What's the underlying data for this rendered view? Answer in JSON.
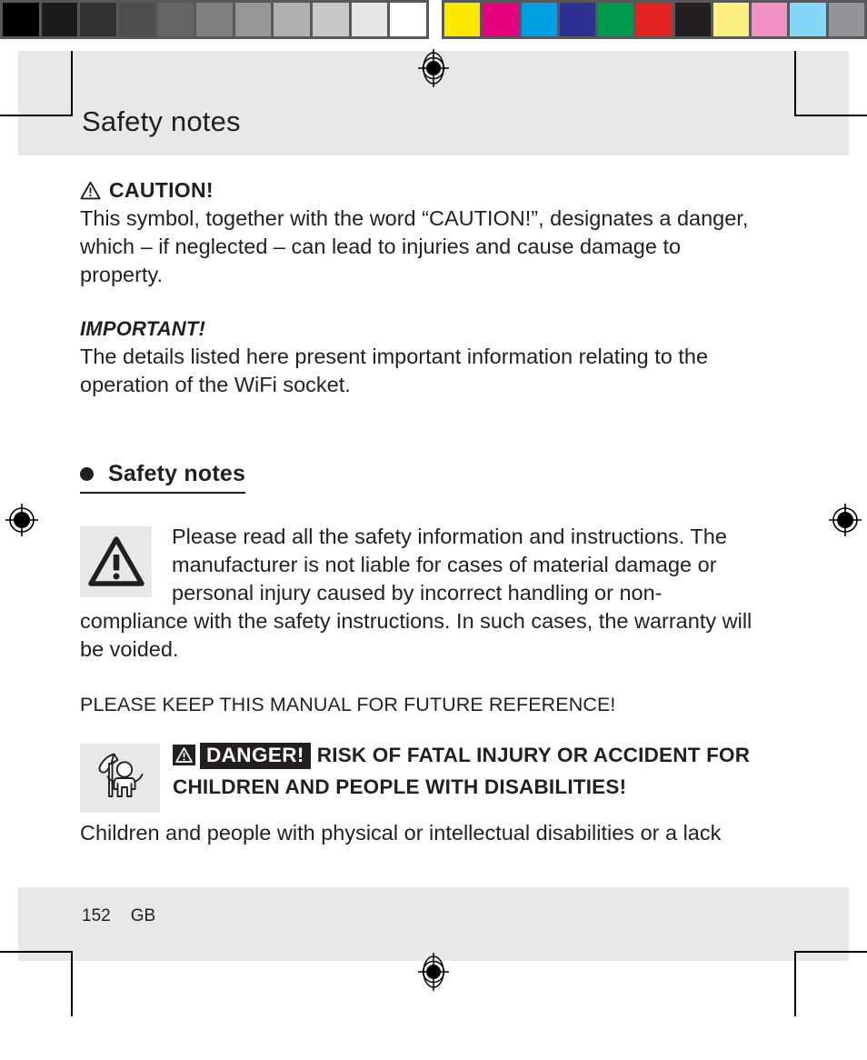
{
  "document": {
    "page_number": "152",
    "language_code": "GB",
    "header_title": "Safety notes"
  },
  "calibration": {
    "grayscale_label": "grayscale-step-wedge",
    "grayscale_swatches": [
      "#000000",
      "#1c1c1c",
      "#323232",
      "#4e4e4e",
      "#646464",
      "#808080",
      "#969696",
      "#b0b0b0",
      "#c8c8c8",
      "#e6e6e6",
      "#ffffff"
    ],
    "color_label": "color-control-bar",
    "color_swatches": [
      "#fbe900",
      "#e5007e",
      "#00a0e3",
      "#2e3192",
      "#009a4e",
      "#e52421",
      "#231f20",
      "#fbef7f",
      "#f291c4",
      "#85d7f7",
      "#939598"
    ]
  },
  "marks": {
    "registration_label": "registration-target",
    "crop_label": "crop-mark"
  },
  "sections": {
    "caution": {
      "icon": "warning-triangle-icon",
      "heading": "CAUTION!",
      "body": "This symbol, together with the word “CAUTION!”, designates a danger, which – if neglected – can lead to injuries and cause damage to property."
    },
    "important": {
      "heading": "IMPORTANT!",
      "body": "The details listed here present important information relating to the operation of the WiFi socket."
    },
    "safety_notes": {
      "heading": "Safety notes",
      "bullet": "filled-bullet",
      "icon": "warning-triangle-icon",
      "body": "Please read all the safety information and instructions. The manufacturer is not liable for cases of material damage or personal injury caused by incorrect handling or non-compliance with the safety instructions. In such cases, the warranty will be voided.",
      "keep_notice": "PLEASE KEEP THIS MANUAL FOR FUTURE REFERENCE!"
    },
    "danger": {
      "icon": "child-reaching-icon",
      "badge_icon": "warning-triangle-icon",
      "badge_label": "DANGER!",
      "heading": "RISK OF FATAL INJURY OR ACCIDENT FOR CHILDREN AND PEOPLE WITH DISABILITIES!",
      "body": "Children and people with physical or intellectual disabilities or a lack"
    }
  },
  "colors": {
    "ink": "#231f20",
    "band": "#e8e8e8",
    "paper": "#ffffff"
  }
}
